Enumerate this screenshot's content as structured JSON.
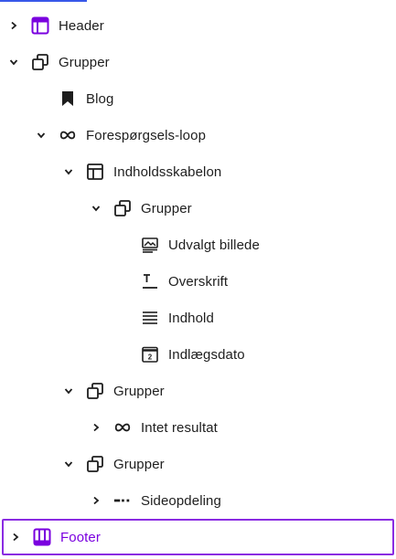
{
  "accent_color": "#3858e9",
  "template_part_color": "#7a00df",
  "tree": [
    {
      "label": "Header",
      "icon": "header-template-part-icon",
      "expanded": false
    },
    {
      "label": "Grupper",
      "icon": "group-icon",
      "expanded": true
    },
    {
      "label": "Blog",
      "icon": "bookmark-icon"
    },
    {
      "label": "Forespørgsels-loop",
      "icon": "loop-icon",
      "expanded": true
    },
    {
      "label": "Indholdsskabelon",
      "icon": "post-template-icon",
      "expanded": true
    },
    {
      "label": "Grupper",
      "icon": "group-icon",
      "expanded": true
    },
    {
      "label": "Udvalgt billede",
      "icon": "featured-image-icon"
    },
    {
      "label": "Overskrift",
      "icon": "post-title-icon"
    },
    {
      "label": "Indhold",
      "icon": "post-content-icon"
    },
    {
      "label": "Indlægsdato",
      "icon": "post-date-icon"
    },
    {
      "label": "Grupper",
      "icon": "group-icon",
      "expanded": true
    },
    {
      "label": "Intet resultat",
      "icon": "loop-icon",
      "expanded": false
    },
    {
      "label": "Grupper",
      "icon": "group-icon",
      "expanded": true
    },
    {
      "label": "Sideopdeling",
      "icon": "pagination-icon",
      "expanded": false
    },
    {
      "label": "Footer",
      "icon": "footer-template-part-icon",
      "expanded": false,
      "selected": true
    }
  ]
}
